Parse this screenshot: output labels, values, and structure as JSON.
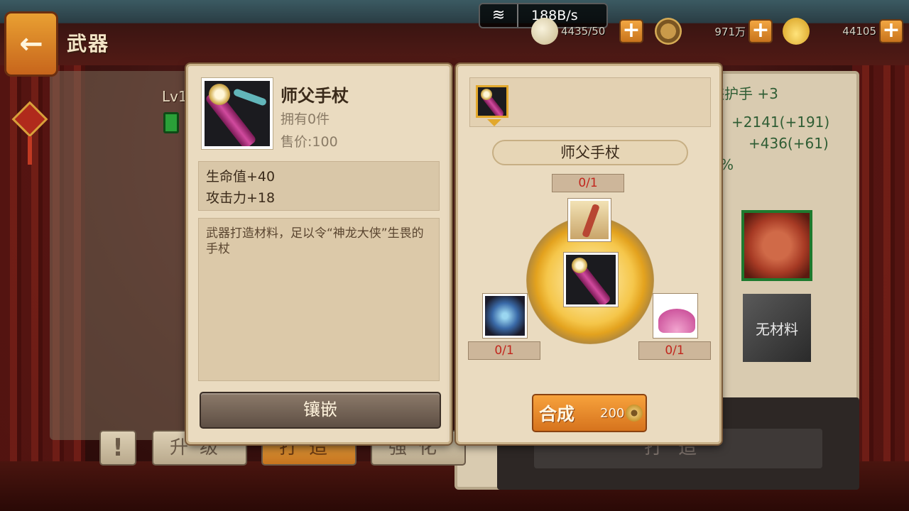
{
  "header": {
    "title": "武器",
    "network": {
      "speed": "188B/s"
    },
    "resources": [
      {
        "icon": "stamina-icon",
        "value": "4435/50"
      },
      {
        "icon": "copper-coin-icon",
        "value": "971万"
      },
      {
        "icon": "gold-ingot-icon",
        "value": "44105"
      }
    ]
  },
  "background": {
    "level_label": "Lv1",
    "equip_name": "侠护手 +3",
    "stat1": "+2141(+191)",
    "stat2": "+436(+61)",
    "percent": "%",
    "no_material": "无材料",
    "tabs": [
      "升级",
      "打造",
      "强化"
    ],
    "active_tab": "打造",
    "forge_button": "打造",
    "alert": "!"
  },
  "item_panel": {
    "name": "师父手杖",
    "owned": "拥有0件",
    "price": "售价:100",
    "stats": [
      "生命值+40",
      "攻击力+18"
    ],
    "description": "武器打造材料，足以令“神龙大侠”生畏的手杖",
    "inlay_button": "镶嵌"
  },
  "synth_panel": {
    "target_name": "师父手杖",
    "materials": [
      {
        "position": "top",
        "count": "0/1"
      },
      {
        "position": "left",
        "count": "0/1"
      },
      {
        "position": "right",
        "count": "0/1"
      }
    ],
    "synth_button": "合成",
    "synth_cost": "200"
  }
}
